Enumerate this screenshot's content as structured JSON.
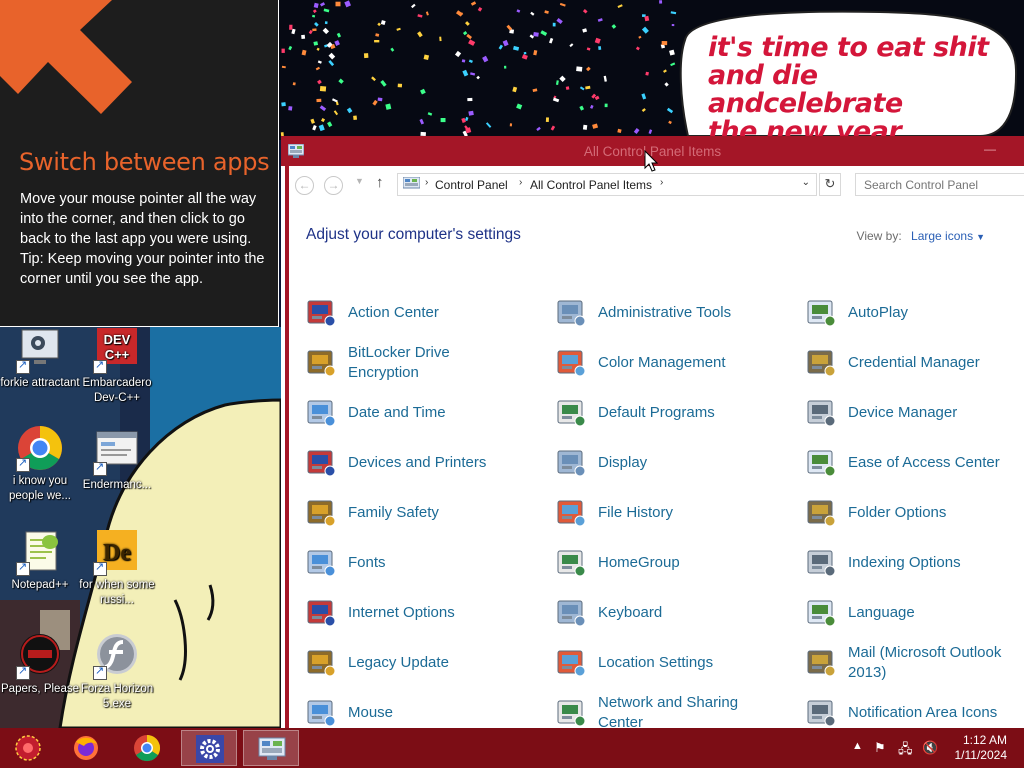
{
  "wallpaper": {
    "bubble_lines": [
      "it's time to eat shit",
      "and die andcelebrate",
      "the new year"
    ]
  },
  "charm_hint": {
    "title": "Switch between apps",
    "body_line1": "Move your mouse pointer all the way into the corner, and then click to go back to the last app you were using.",
    "body_line2": "Tip: Keep moving your pointer into the corner until you see the app."
  },
  "desktop_icons": [
    {
      "label": "forkie attractant",
      "icon": "gear-screen-icon"
    },
    {
      "label": "Embarcadero Dev-C++",
      "icon": "devcpp-icon"
    },
    {
      "label": "i know you people we...",
      "icon": "chrome-icon"
    },
    {
      "label": "Endermanc...",
      "icon": "app-window-icon"
    },
    {
      "label": "Notepad++",
      "icon": "notepadpp-icon"
    },
    {
      "label": "for when some russi...",
      "icon": "de-icon"
    },
    {
      "label": "Papers, Please",
      "icon": "papers-please-icon"
    },
    {
      "label": "Forza Horizon 5.exe",
      "icon": "flash-icon"
    }
  ],
  "window": {
    "title": "All Control Panel Items",
    "breadcrumb": [
      "Control Panel",
      "All Control Panel Items"
    ],
    "search_placeholder": "Search Control Panel",
    "heading": "Adjust your computer's settings",
    "view_by_label": "View by:",
    "view_by_value": "Large icons"
  },
  "control_panel_items": [
    [
      "Action Center",
      "Administrative Tools",
      "AutoPlay"
    ],
    [
      "BitLocker Drive Encryption",
      "Color Management",
      "Credential Manager"
    ],
    [
      "Date and Time",
      "Default Programs",
      "Device Manager"
    ],
    [
      "Devices and Printers",
      "Display",
      "Ease of Access Center"
    ],
    [
      "Family Safety",
      "File History",
      "Folder Options"
    ],
    [
      "Fonts",
      "HomeGroup",
      "Indexing Options"
    ],
    [
      "Internet Options",
      "Keyboard",
      "Language"
    ],
    [
      "Legacy Update",
      "Location Settings",
      "Mail (Microsoft Outlook 2013)"
    ],
    [
      "Mouse",
      "Network and Sharing Center",
      "Notification Area Icons"
    ]
  ],
  "taskbar": {
    "apps": [
      "start-orb-icon",
      "firefox-icon",
      "chrome-icon",
      "settings-icon",
      "control-panel-icon"
    ],
    "time": "1:12 AM",
    "date": "1/11/2024"
  },
  "colors": {
    "accent": "#a41627",
    "taskbar": "#7c0d15",
    "link": "#1c6b96",
    "heading": "#1e3287",
    "hint_title": "#e8632b"
  }
}
